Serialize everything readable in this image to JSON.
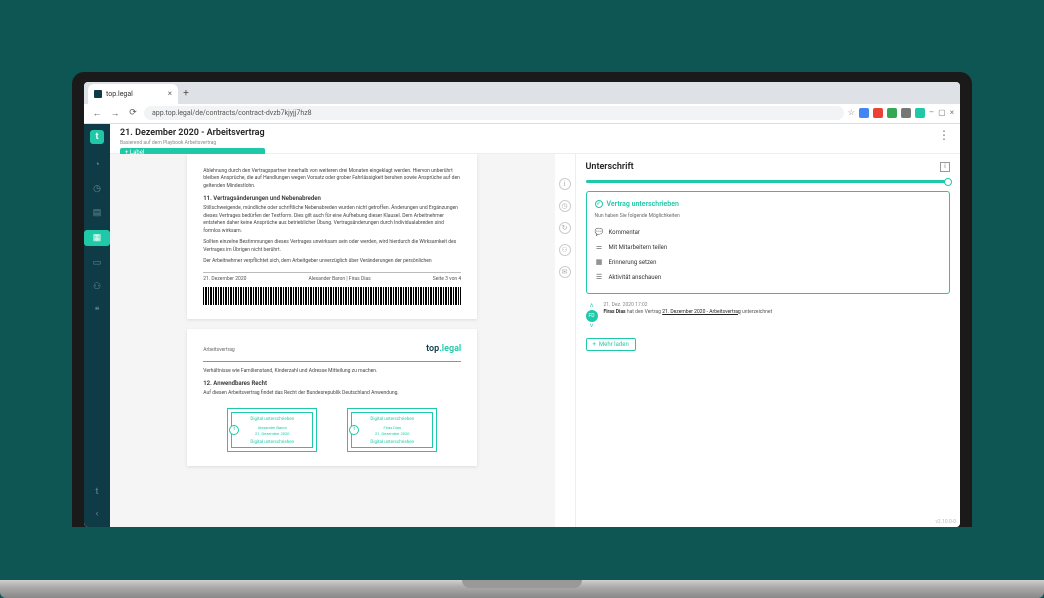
{
  "browser": {
    "tab_title": "top.legal",
    "url": "app.top.legal/de/contracts/contract-dvzb7kjyjj7hz8"
  },
  "header": {
    "title": "21. Dezember 2020 - Arbeitsvertrag",
    "subtitle": "Basierend auf dem Playbook Arbeitsvertrag",
    "label": "+ Label"
  },
  "doc": {
    "para1": "Ablehnung durch den Vertragspartner innerhalb von weiteren drei Monaten eingeklagt werden. Hiervon unberührt bleiben Ansprüche, die auf Handlungen wegen Vorsatz oder grober Fahrlässigkeit beruhen sowie Ansprüche auf den geltenden Mindestlohn.",
    "h11": "11. Vertragsänderungen und Nebenabreden",
    "para2": "Stillschweigende, mündliche oder schriftliche Nebenabreden wurden nicht getroffen. Änderungen und Ergänzungen dieses Vertrages bedürfen der Textform. Dies gilt auch für eine Aufhebung dieser Klausel. Dem Arbeitnehmer entstehen daher keine Ansprüche aus betrieblicher Übung. Vertragsänderungen durch Individualabreden sind formlos wirksam.",
    "para3": "Sollten einzelne Bestimmungen dieses Vertrages unwirksam sein oder werden, wird hierdurch die Wirksamkeit des Vertrages im Übrigen nicht berührt.",
    "para4": "Der Arbeitnehmer verpflichtet sich, dem Arbeitgeber unverzüglich über Veränderungen der persönlichen",
    "footer_date": "21. Dezember 2020",
    "footer_name": "Alexander Baron | Firas Dias",
    "footer_page": "Seite 3 von 4",
    "page2_label": "Arbeitsvertrag",
    "brand_a": "top",
    "brand_b": ".legal",
    "para5": "Verhältnisse wie Familienstand, Kinderzahl und Adresse Mitteilung zu machen.",
    "h12": "12. Anwendbares Recht",
    "para6": "Auf diesen Arbeitsvertrag findet das Recht der Bundesrepublik Deutschland Anwendung.",
    "sig_title": "Digital unterschrieben",
    "sig1_name": "Alexander Baron",
    "sig1_date": "21. Dezember 2020",
    "sig2_name": "Firas Dias",
    "sig2_date": "21. Dezember 2020",
    "sig_sub": "Digital unterschrieben"
  },
  "panel": {
    "title": "Unterschrift",
    "status": "Vertrag unterschrieben",
    "hint": "Nun haben Sie folgende Möglichkeiten",
    "actions": {
      "comment": "Kommentar",
      "share": "Mit Mitarbeitern teilen",
      "reminder": "Erinnerung setzen",
      "activity": "Aktivität anschauen"
    },
    "log": {
      "time": "21. Dez. 2020 17:02",
      "user": "Firas Dias",
      "mid": " hat den Vertrag ",
      "link": "21. Dezember 2020 - Arbeitsvertrag",
      "tail": " unterzeichnet"
    },
    "load_more": "Mehr laden"
  },
  "version": "v2.10.0-0"
}
